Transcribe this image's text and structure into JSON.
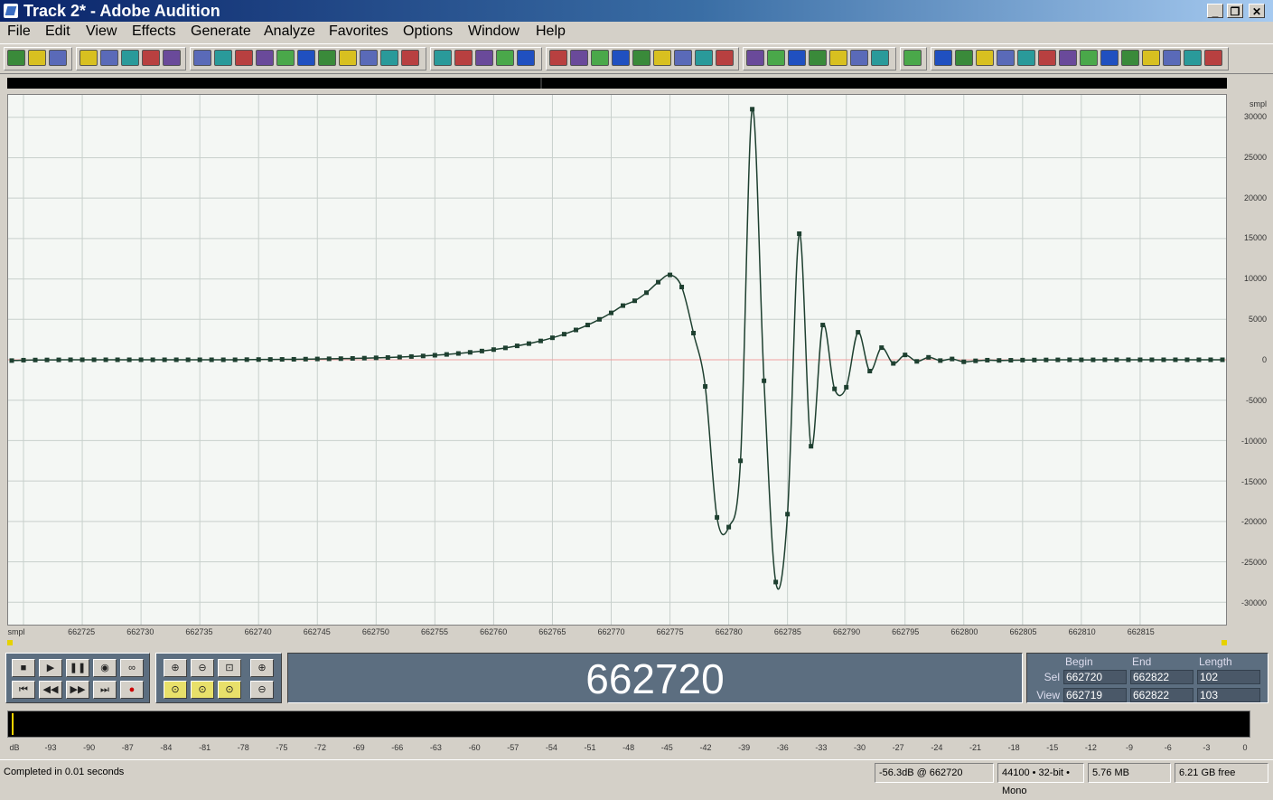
{
  "window": {
    "title": "Track 2* - Adobe Audition"
  },
  "menu": [
    "File",
    "Edit",
    "View",
    "Effects",
    "Generate",
    "Analyze",
    "Favorites",
    "Options",
    "Window",
    "Help"
  ],
  "toolbar_icons": [
    "multitrack-view-icon",
    "edit-view-icon",
    "cd-view-icon",
    "new-file-icon",
    "open-file-icon",
    "save-icon",
    "save-all-icon",
    "save-selection-icon",
    "undo-icon",
    "redo-icon",
    "repeat-icon",
    "copy-new-icon",
    "copy-icon",
    "cut-icon",
    "paste-icon",
    "paste-new-icon",
    "mix-paste-icon",
    "trim-icon",
    "envelope-icon",
    "spectral-icon",
    "snap-icon",
    "grid-icon",
    "zoom-icon",
    "time-icon",
    "levels-icon",
    "frequency-icon",
    "settings-icon",
    "effect-icon",
    "noise-reduction-icon",
    "equalizer-icon",
    "filter-icon",
    "amplify-icon",
    "normalize-icon",
    "batch-icon",
    "analysis-icon",
    "plugin-icon"
  ],
  "waveform": {
    "y_unit": "smpl",
    "y_ticks": [
      "30000",
      "25000",
      "20000",
      "15000",
      "10000",
      "5000",
      "0",
      "-5000",
      "-10000",
      "-15000",
      "-20000",
      "-25000",
      "-30000"
    ],
    "x_unit": "smpl",
    "x_ticks": [
      "662725",
      "662730",
      "662735",
      "662740",
      "662745",
      "662750",
      "662755",
      "662760",
      "662765",
      "662770",
      "662775",
      "662780",
      "662785",
      "662790",
      "662795",
      "662800",
      "662805",
      "662810",
      "662815"
    ]
  },
  "chart_data": {
    "type": "line",
    "title": "",
    "xlabel": "smpl",
    "ylabel": "smpl",
    "xlim": [
      662719,
      662822
    ],
    "ylim": [
      -32768,
      32767
    ],
    "grid": true,
    "x_start": 662719,
    "values": [
      -100,
      -50,
      -30,
      -20,
      -10,
      0,
      0,
      0,
      0,
      0,
      0,
      0,
      0,
      0,
      0,
      0,
      0,
      0,
      0,
      0,
      20,
      30,
      40,
      50,
      60,
      80,
      100,
      120,
      140,
      170,
      200,
      240,
      280,
      330,
      400,
      470,
      560,
      660,
      780,
      920,
      1080,
      1260,
      1470,
      1720,
      2000,
      2330,
      2720,
      3170,
      3690,
      4300,
      5000,
      5800,
      6700,
      7300,
      8300,
      9600,
      10500,
      9000,
      3300,
      -3300,
      -19500,
      -20700,
      -12500,
      31000,
      -2600,
      -27500,
      -19100,
      15600,
      -10700,
      4300,
      -3600,
      -3400,
      3400,
      -1400,
      1500,
      -450,
      600,
      -200,
      300,
      -100,
      100,
      -250,
      -130,
      -50,
      -80,
      -60,
      -40,
      -30,
      -20,
      -10,
      0,
      -10,
      -10,
      0,
      0,
      0,
      0,
      0,
      0,
      0,
      0,
      0,
      0,
      0
    ]
  },
  "transport": [
    "stop-icon",
    "play-icon",
    "pause-icon",
    "play-to-end-icon",
    "loop-icon",
    "go-to-start-icon",
    "rewind-icon",
    "fast-forward-icon",
    "go-to-end-icon",
    "record-icon"
  ],
  "zoom": [
    "zoom-in-horizontal-icon",
    "zoom-out-horizontal-icon",
    "zoom-full-icon",
    "zoom-in-vertical-icon",
    "zoom-selection-icon",
    "zoom-left-icon",
    "zoom-right-icon",
    "zoom-out-vertical-icon"
  ],
  "time_display": "662720",
  "selection": {
    "begin_label": "Begin",
    "end_label": "End",
    "length_label": "Length",
    "sel_label": "Sel",
    "view_label": "View",
    "sel_begin": "662720",
    "sel_end": "662822",
    "sel_length": "102",
    "view_begin": "662719",
    "view_end": "662822",
    "view_length": "103"
  },
  "meter": {
    "unit": "dB",
    "ticks": [
      "-93",
      "-90",
      "-87",
      "-84",
      "-81",
      "-78",
      "-75",
      "-72",
      "-69",
      "-66",
      "-63",
      "-60",
      "-57",
      "-54",
      "-51",
      "-48",
      "-45",
      "-42",
      "-39",
      "-36",
      "-33",
      "-30",
      "-27",
      "-24",
      "-21",
      "-18",
      "-15",
      "-12",
      "-9",
      "-6",
      "-3",
      "0"
    ]
  },
  "status": {
    "message": "Completed in 0.01 seconds",
    "level": "-56.3dB @ 662720",
    "format": "44100 • 32-bit • Mono",
    "size": "5.76 MB",
    "free": "6.21 GB free"
  },
  "colors": {
    "wave": "#1e4030",
    "background": "#f4f7f4",
    "grid": "#c8d0cc",
    "panel": "#5c6e80"
  }
}
